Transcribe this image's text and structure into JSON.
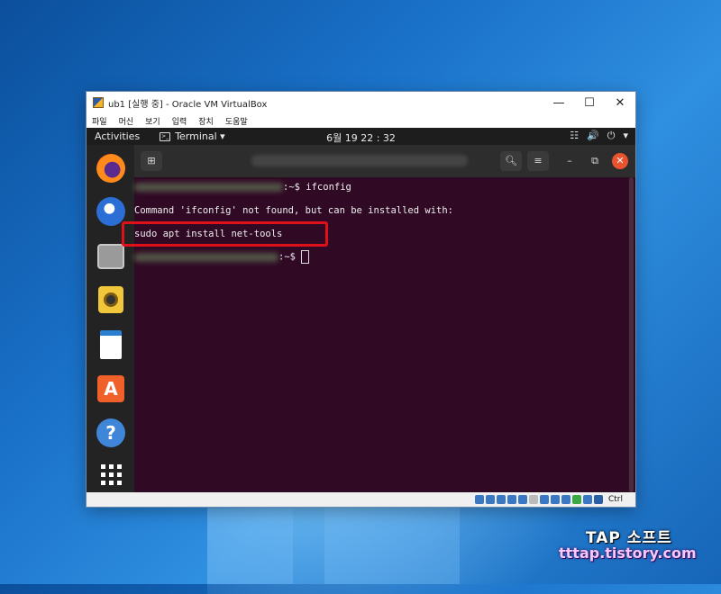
{
  "window": {
    "title": "ub1 [실행 중] - Oracle VM VirtualBox",
    "minimize": "—",
    "maximize": "☐",
    "close": "✕",
    "menu": [
      "파일",
      "머신",
      "보기",
      "입력",
      "장치",
      "도움말"
    ]
  },
  "gnome": {
    "activities": "Activities",
    "app_menu": "Terminal ▾",
    "clock": "6월 19  22 : 32",
    "tray": [
      "network-icon",
      "volume-icon",
      "power-icon"
    ]
  },
  "dock": [
    "firefox-icon",
    "thunderbird-icon",
    "files-icon",
    "rhythmbox-icon",
    "libreoffice-writer-icon",
    "software-store-icon",
    "help-icon",
    "show-apps-icon"
  ],
  "terminal": {
    "prompt1_suffix": ":~$ ifconfig",
    "error": "Command 'ifconfig' not found, but can be installed with:",
    "suggestion": "sudo apt install net-tools",
    "prompt2_suffix": ":~$ "
  },
  "statusbar": {
    "host_key": "Ctrl"
  },
  "watermark": {
    "line1": "TAP 소프트",
    "line2": "tttap.tistory.com"
  },
  "colors": {
    "terminal_bg": "#300a24",
    "highlight": "#e0101a"
  }
}
